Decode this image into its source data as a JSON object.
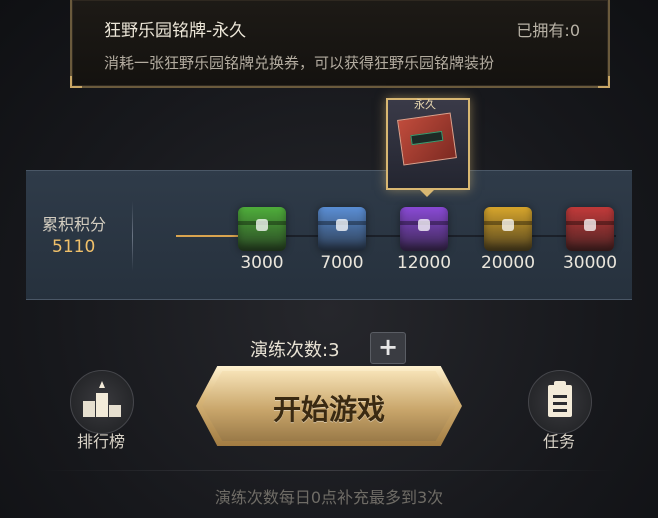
{
  "tooltip": {
    "title": "狂野乐园铭牌-永久",
    "owned": "已拥有:0",
    "description": "消耗一张狂野乐园铭牌兑换券，可以获得狂野乐园铭牌装扮"
  },
  "reward": {
    "tag": "永久",
    "item_icon": "nameplate-icon"
  },
  "progress": {
    "label": "累积积分",
    "value": "5110",
    "milestones": [
      {
        "label": "3000",
        "color": "#4fae3b",
        "icon": "green-chest-icon"
      },
      {
        "label": "7000",
        "color": "#5b8fd6",
        "icon": "blue-chest-icon"
      },
      {
        "label": "12000",
        "color": "#8a4ad6",
        "icon": "purple-chest-icon"
      },
      {
        "label": "20000",
        "color": "#d8a62c",
        "icon": "gold-chest-icon"
      },
      {
        "label": "30000",
        "color": "#c23a3a",
        "icon": "red-chest-icon"
      }
    ]
  },
  "practice": {
    "label": "演练次数:3",
    "plus_icon": "plus-icon"
  },
  "actions": {
    "start_label": "开始游戏",
    "leaderboard_label": "排行榜",
    "tasks_label": "任务"
  },
  "footer": {
    "note": "演练次数每日0点补充最多到3次"
  }
}
